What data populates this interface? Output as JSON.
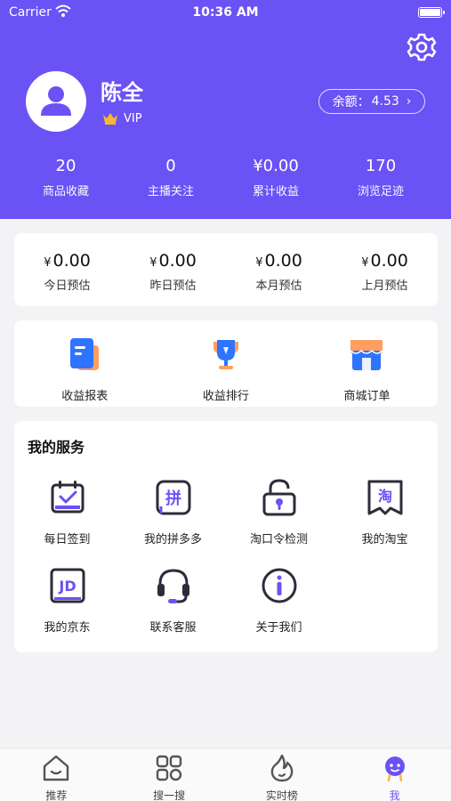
{
  "status_bar": {
    "carrier": "Carrier",
    "time": "10:36 AM"
  },
  "profile": {
    "name": "陈全",
    "badge": "VIP",
    "balance_label": "余额：",
    "balance_value": "4.53",
    "balance_chevron": "›"
  },
  "stats": [
    {
      "value": "20",
      "label": "商品收藏"
    },
    {
      "value": "0",
      "label": "主播关注"
    },
    {
      "value": "¥0.00",
      "label": "累计收益"
    },
    {
      "value": "170",
      "label": "浏览足迹"
    }
  ],
  "earnings": {
    "currency": "¥",
    "items": [
      {
        "value": "0.00",
        "label": "今日预估"
      },
      {
        "value": "0.00",
        "label": "昨日预估"
      },
      {
        "value": "0.00",
        "label": "本月预估"
      },
      {
        "value": "0.00",
        "label": "上月预估"
      }
    ]
  },
  "menus": [
    {
      "label": "收益报表",
      "icon": "report-icon"
    },
    {
      "label": "收益排行",
      "icon": "trophy-icon"
    },
    {
      "label": "商城订单",
      "icon": "store-icon"
    }
  ],
  "services": {
    "title": "我的服务",
    "items": [
      {
        "label": "每日签到",
        "icon": "calendar-check-icon"
      },
      {
        "label": "我的拼多多",
        "icon": "pinduoduo-icon",
        "glyph": "拼"
      },
      {
        "label": "淘口令检测",
        "icon": "unlock-icon"
      },
      {
        "label": "我的淘宝",
        "icon": "taobao-icon",
        "glyph": "淘"
      },
      {
        "label": "我的京东",
        "icon": "jd-icon",
        "glyph": "JD"
      },
      {
        "label": "联系客服",
        "icon": "headset-icon"
      },
      {
        "label": "关于我们",
        "icon": "info-icon"
      }
    ]
  },
  "tabs": [
    {
      "label": "推荐",
      "icon": "home-icon",
      "active": false
    },
    {
      "label": "搜一搜",
      "icon": "grid-icon",
      "active": false
    },
    {
      "label": "实时榜",
      "icon": "flame-icon",
      "active": false
    },
    {
      "label": "我",
      "icon": "profile-face-icon",
      "active": true
    }
  ],
  "colors": {
    "accent": "#6a52f5",
    "icon_dark": "#2c2c3a",
    "orange": "#ff8a3d",
    "blue": "#2f74ff",
    "gold": "#f5b832"
  }
}
